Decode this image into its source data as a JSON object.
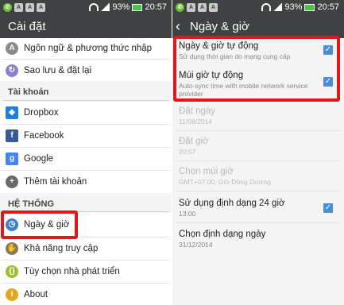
{
  "status_bar": {
    "battery": "93%",
    "time": "20:57"
  },
  "left": {
    "title": "Cài đặt",
    "items_top": [
      {
        "label": "Ngôn ngữ & phương thức nhập",
        "icon": "language-icon"
      },
      {
        "label": "Sao lưu & đặt lại",
        "icon": "backup-icon"
      }
    ],
    "section_accounts": "Tài khoản",
    "accounts": [
      {
        "label": "Dropbox",
        "icon": "dropbox-icon"
      },
      {
        "label": "Facebook",
        "icon": "facebook-icon"
      },
      {
        "label": "Google",
        "icon": "google-icon"
      },
      {
        "label": "Thêm tài khoản",
        "icon": "add-account-icon"
      }
    ],
    "section_system": "HỆ THỐNG",
    "system": [
      {
        "label": "Ngày & giờ",
        "icon": "clock-icon"
      },
      {
        "label": "Khả năng truy cập",
        "icon": "accessibility-icon"
      },
      {
        "label": "Tùy chọn nhà phát triển",
        "icon": "developer-icon"
      },
      {
        "label": "About",
        "icon": "info-icon"
      }
    ],
    "colors": {
      "highlight": "#e3171a"
    }
  },
  "right": {
    "title": "Ngày & giờ",
    "settings": [
      {
        "title": "Ngày & giờ tự động",
        "summary": "Sử dụng thời gian do mạng cung cấp",
        "checked": true,
        "enabled": true
      },
      {
        "title": "Múi giờ tự động",
        "summary": "Auto-sync time with mobile network service provider",
        "checked": true,
        "enabled": true
      },
      {
        "title": "Đặt ngày",
        "summary": "11/08/2014",
        "enabled": false
      },
      {
        "title": "Đặt giờ",
        "summary": "20:57",
        "enabled": false
      },
      {
        "title": "Chọn múi giờ",
        "summary": "GMT+07:00, Giờ Đông Dương",
        "enabled": false
      },
      {
        "title": "Sử dụng định dạng 24 giờ",
        "summary": "13:00",
        "checked": true,
        "enabled": true
      },
      {
        "title": "Chọn định dạng ngày",
        "summary": "31/12/2014",
        "enabled": true
      }
    ]
  }
}
